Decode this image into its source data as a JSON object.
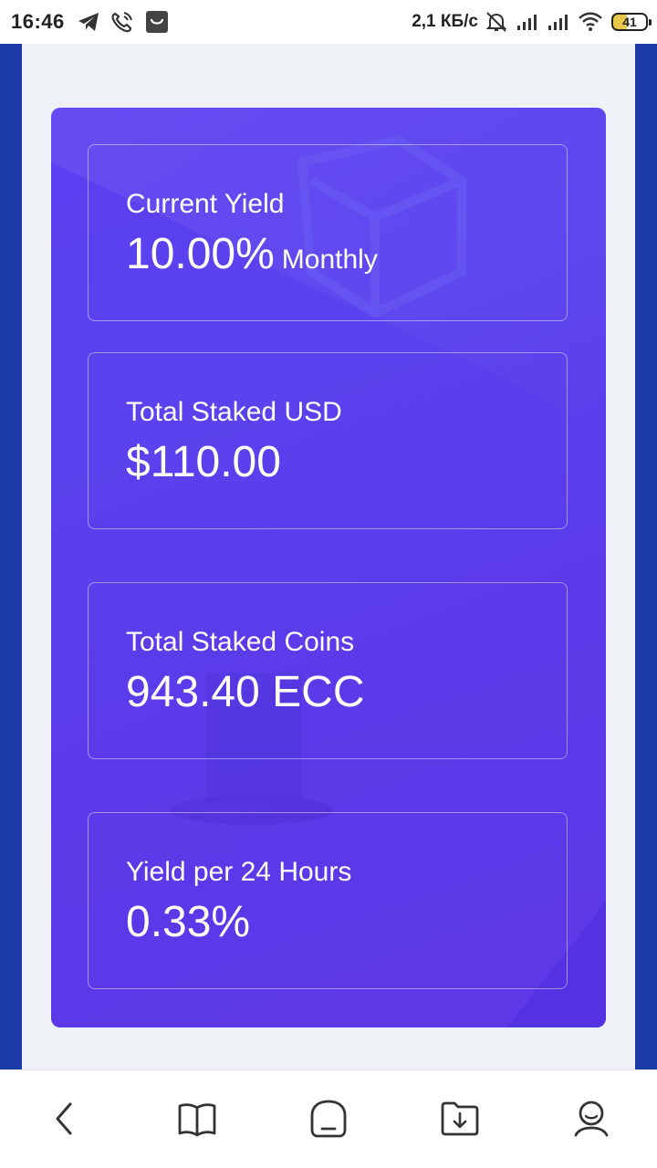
{
  "status_bar": {
    "time": "16:46",
    "net_speed": "2,1 КБ/с",
    "battery": "41",
    "icons": [
      "telegram-icon",
      "phone-call-icon",
      "shopping-bag-icon",
      "alarm-off-icon",
      "signal-icon",
      "signal-icon",
      "wifi-icon",
      "battery-icon"
    ]
  },
  "stats": [
    {
      "label": "Current Yield",
      "value": "10.00%",
      "unit": "Monthly"
    },
    {
      "label": "Total Staked USD",
      "value": "$110.00"
    },
    {
      "label": "Total Staked Coins",
      "value": "943.40 ECC"
    },
    {
      "label": "Yield per 24 Hours",
      "value": "0.33%"
    }
  ],
  "colors": {
    "app_background": "#1b3aa6",
    "card_background": "#eef2f7",
    "panel_gradient": "#5a3ff0",
    "text": "#ffffff"
  },
  "bottom_nav": {
    "items": [
      "back-icon",
      "book-icon",
      "home-icon",
      "download-folder-icon",
      "profile-icon"
    ]
  }
}
